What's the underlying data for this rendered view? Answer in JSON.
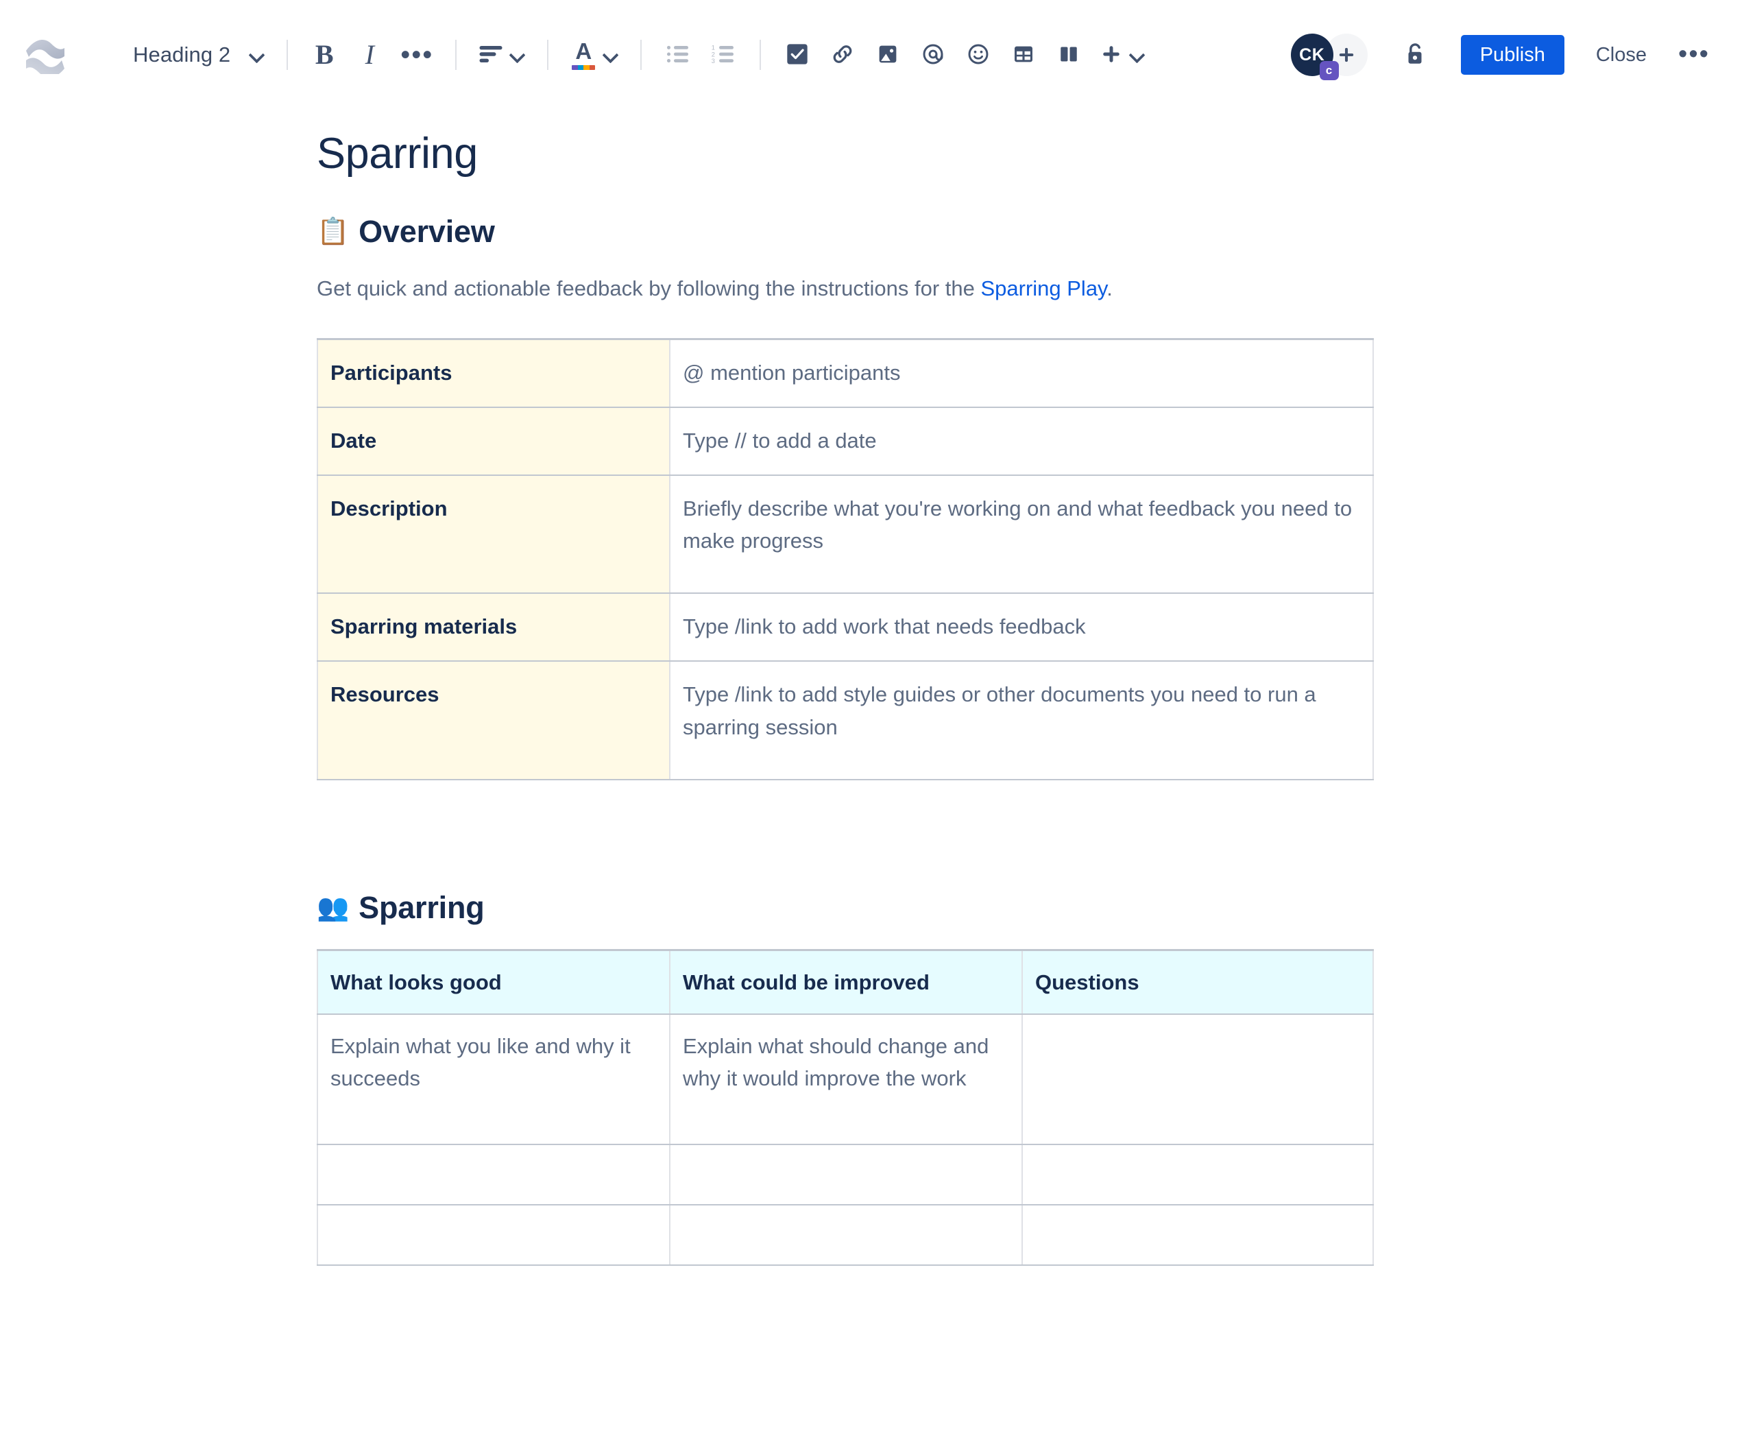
{
  "toolbar": {
    "logo_name": "confluence-logo",
    "block_type": "Heading 2",
    "bold_label": "B",
    "italic_label": "I",
    "more_formatting_label": "•••",
    "align_icon": "text-align-icon",
    "text_color_icon": "text-color-icon",
    "bullet_list_icon": "bullet-list-icon",
    "numbered_list_icon": "numbered-list-icon",
    "task_icon": "task-checkbox-icon",
    "link_icon": "link-icon",
    "image_icon": "image-icon",
    "mention_icon": "mention-icon",
    "emoji_icon": "emoji-icon",
    "table_icon": "table-icon",
    "layout_icon": "layout-columns-icon",
    "insert_icon": "plus-icon",
    "avatar_initials": "CK",
    "avatar_badge": "c",
    "add_person_label": "+",
    "lock_icon": "unlock-icon",
    "publish_label": "Publish",
    "close_label": "Close",
    "more_label": "•••",
    "accent_color": "#0c5ce0",
    "avatar_color": "#172b4d",
    "badge_color": "#6554c0"
  },
  "document": {
    "title": "Sparring",
    "sections": [
      {
        "emoji": "📋",
        "heading": "Overview",
        "paragraph_before_link": "Get quick and actionable feedback by following the instructions for the ",
        "link_text": "Sparring Play",
        "paragraph_after_link": "."
      },
      {
        "emoji": "👥",
        "heading": "Sparring"
      }
    ],
    "overview_table": {
      "rows": [
        {
          "key": "Participants",
          "value": "@ mention participants"
        },
        {
          "key": "Date",
          "value": "Type // to add a date"
        },
        {
          "key": "Description",
          "value": "Briefly describe what you're working on and what feedback you need to make progress"
        },
        {
          "key": "Sparring materials",
          "value": "Type /link to add work that needs feedback"
        },
        {
          "key": "Resources",
          "value": "Type /link to add style guides or other documents you need to run a sparring session"
        }
      ],
      "key_bg": "#fffae6"
    },
    "sparring_table": {
      "headers": [
        "What looks good",
        "What could be improved",
        "Questions"
      ],
      "header_bg": "#e6fcff",
      "rows": [
        [
          "Explain what you like and why it succeeds",
          "Explain what should change and why it would improve the work",
          ""
        ],
        [
          "",
          "",
          ""
        ],
        [
          "",
          "",
          ""
        ]
      ]
    }
  }
}
